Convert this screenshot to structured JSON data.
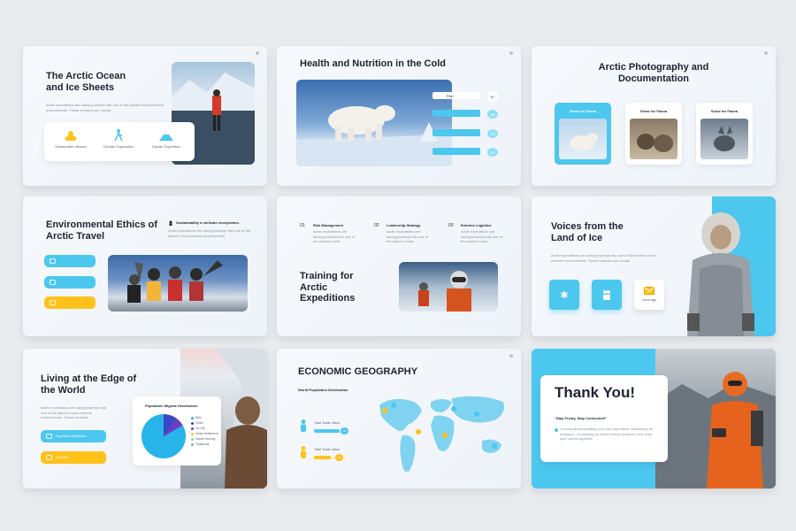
{
  "slides": {
    "s1": {
      "title": "The Arctic Ocean and Ice Sheets",
      "body": "Arctic expeditions are daring journeys into one of the planet's most extreme environments. These ventures are crucial",
      "features": [
        {
          "label": "Sustainable Mission",
          "icon": "hands-leaf-icon"
        },
        {
          "label": "Climate Exploration",
          "icon": "hiker-icon"
        },
        {
          "label": "Glacier Expedition",
          "icon": "mountain-icon"
        }
      ]
    },
    "s2": {
      "title": "Health and Nutrition in the Cold",
      "rows": [
        {
          "label": "Fish",
          "value": "97"
        },
        {
          "label": "",
          "value": "88"
        },
        {
          "label": "",
          "value": "71"
        },
        {
          "label": "",
          "value": "54"
        }
      ]
    },
    "s3": {
      "title": "Arctic Photography and Documentation",
      "cards": [
        {
          "label": "Snow Ice Fauna"
        },
        {
          "label": "Snow Ice Fauna"
        },
        {
          "label": "Snow Ice Fauna"
        }
      ]
    },
    "s4": {
      "title": "Environmental Ethics of Arctic Travel",
      "callout_title": "Sustainability in delicate ecosystems.",
      "callout_body": "Arctic expeditions are daring journeys into one of the planet's most extreme environments."
    },
    "s5": {
      "title": "Training for Arctic Expeditions",
      "columns": [
        {
          "num": "01",
          "title": "Risk Management",
          "body": "Arctic expeditions are daring journeys into one of the planet's most"
        },
        {
          "num": "02",
          "title": "Leadership Strategy",
          "body": "Arctic expeditions are daring journeys into one of the planet's most"
        },
        {
          "num": "03",
          "title": "Extreme Logistics",
          "body": "Arctic expeditions are daring journeys into one of the planet's most"
        }
      ]
    },
    "s6": {
      "title": "Voices from the Land of Ice",
      "body": "Arctic expeditions are daring journeys into one of the planet's most extreme environments. These ventures are crucial",
      "tiles": [
        {
          "label": "",
          "icon": "snowflake-icon"
        },
        {
          "label": "",
          "icon": "people-icon"
        },
        {
          "label": "Leverage",
          "icon": "envelope-icon"
        }
      ]
    },
    "s7": {
      "title": "Living at the Edge of the World",
      "body": "Arctic expeditions are daring journeys into one of the planet's most extreme environments. These ventures",
      "popup_title": "Population Migrate Distribution",
      "legend": [
        "Wild",
        "Cities",
        "Ice Life",
        "Urban Settlement",
        "Marine Hunting",
        "Traditional"
      ],
      "pills": [
        "Population Distribution",
        "Migration"
      ]
    },
    "s8": {
      "title": "ECONOMIC GEOGRAPHY",
      "subtitle": "World Population Distribution",
      "rows": [
        {
          "label": "Total Trade Value",
          "value": "75"
        },
        {
          "label": "Total Trade Value",
          "value": "50"
        }
      ]
    },
    "s9": {
      "title": "Thank You!",
      "quote": "\"Stay Frosty, Stay Connected!\"",
      "body": "Curious about updating your own expedition, advertising an endeavor, or planning an Arctic-themed project? Let's chart your course together."
    }
  },
  "colors": {
    "accent_blue": "#4cc7ee",
    "accent_yellow": "#ffc21a",
    "title": "#1d2430"
  }
}
